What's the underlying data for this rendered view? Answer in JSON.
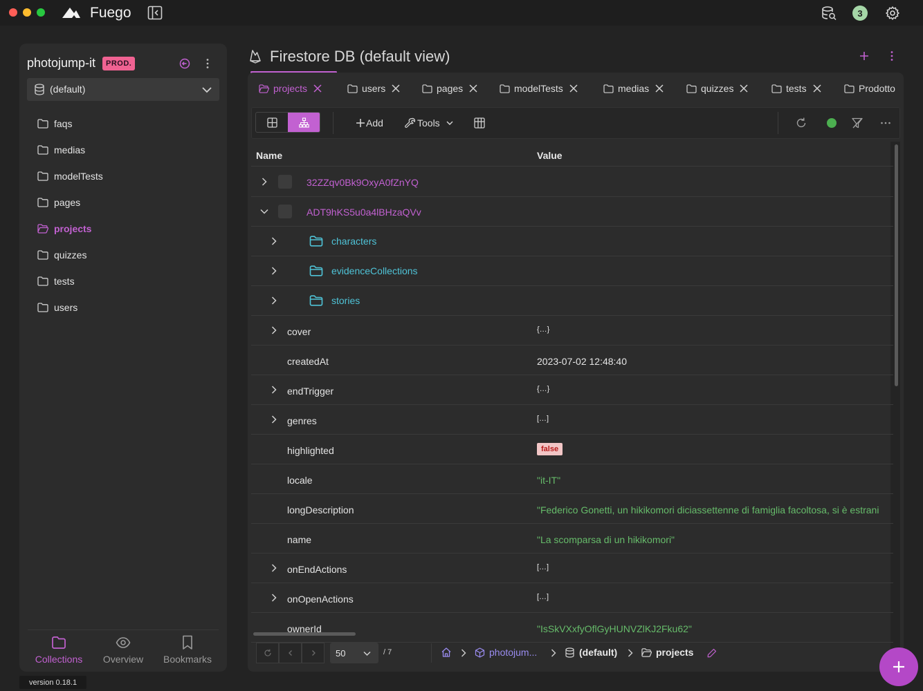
{
  "app": {
    "name": "Fuego",
    "notification_count": "3",
    "version": "version 0.18.1"
  },
  "sidebar": {
    "project_name": "photojump-it",
    "project_badge": "PROD.",
    "database": "(default)",
    "collections": [
      {
        "label": "faqs"
      },
      {
        "label": "medias"
      },
      {
        "label": "modelTests"
      },
      {
        "label": "pages"
      },
      {
        "label": "projects",
        "active": true
      },
      {
        "label": "quizzes"
      },
      {
        "label": "tests"
      },
      {
        "label": "users"
      }
    ],
    "bottom_tabs": [
      {
        "label": "Collections",
        "active": true
      },
      {
        "label": "Overview"
      },
      {
        "label": "Bookmarks"
      }
    ]
  },
  "main": {
    "title": "Firestore DB (default view)",
    "tabs": [
      {
        "label": "projects",
        "active": true
      },
      {
        "label": "users"
      },
      {
        "label": "pages"
      },
      {
        "label": "modelTests"
      },
      {
        "label": "medias"
      },
      {
        "label": "quizzes"
      },
      {
        "label": "tests"
      },
      {
        "label": "Prodotto"
      }
    ],
    "toolbar": {
      "add_label": "Add",
      "tools_label": "Tools"
    },
    "grid": {
      "columns": [
        "Name",
        "Value"
      ],
      "documents": [
        "32ZZqv0Bk9OxyA0fZnYQ",
        "ADT9hKS5u0a4lBHzaQVv"
      ],
      "subcollections": [
        "characters",
        "evidenceCollections",
        "stories"
      ],
      "fields": [
        {
          "name": "cover",
          "value": "{…}",
          "expandable": true
        },
        {
          "name": "createdAt",
          "value": "2023-07-02 12:48:40"
        },
        {
          "name": "endTrigger",
          "value": "{…}",
          "expandable": true
        },
        {
          "name": "genres",
          "value": "[…]",
          "expandable": true
        },
        {
          "name": "highlighted",
          "value": "false",
          "type": "boolean"
        },
        {
          "name": "locale",
          "value": "\"it-IT\"",
          "type": "string"
        },
        {
          "name": "longDescription",
          "value": "\"Federico Gonetti, un hikikomori diciassettenne di famiglia facoltosa, si è estrani",
          "type": "string"
        },
        {
          "name": "name",
          "value": "\"La scomparsa di un hikikomori\"",
          "type": "string"
        },
        {
          "name": "onEndActions",
          "value": "[…]",
          "expandable": true
        },
        {
          "name": "onOpenActions",
          "value": "[…]",
          "expandable": true
        },
        {
          "name": "ownerId",
          "value": "\"IsSkVXxfyOflGyHUNVZlKJ2Fku62\"",
          "type": "string"
        }
      ]
    },
    "footer": {
      "page_size": "50",
      "page_total": "/ 7",
      "breadcrumb_project": "photojum...",
      "breadcrumb_db": "(default)",
      "breadcrumb_collection": "projects"
    }
  },
  "colors": {
    "accent": "#c261d1",
    "string_value": "#66bb6a",
    "subcollection": "#4fc3d7",
    "prod_badge": "#f06292"
  }
}
